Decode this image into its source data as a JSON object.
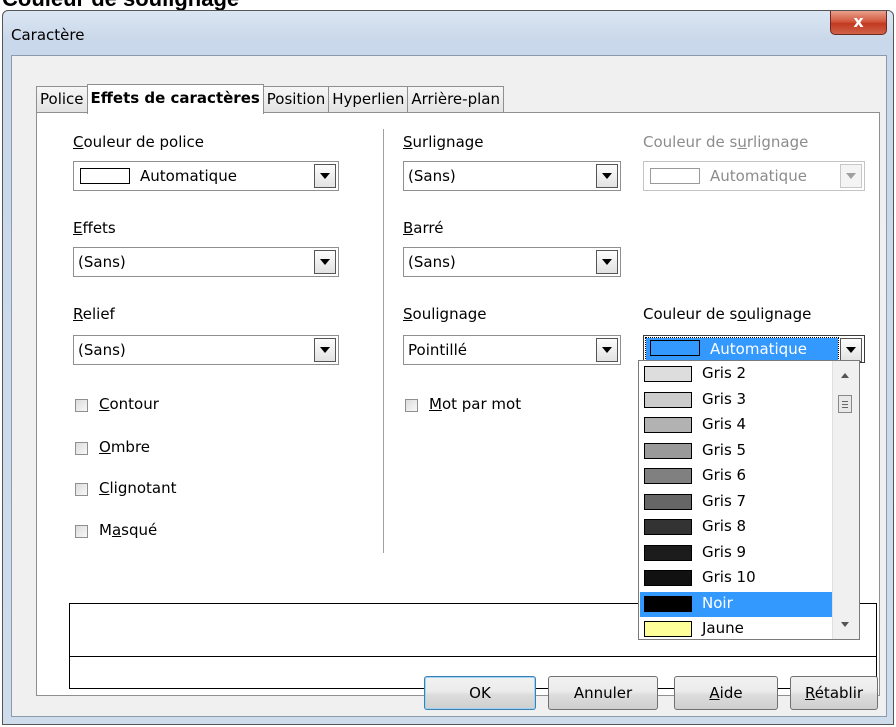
{
  "page_heading": "Couleur de soulignage",
  "dialog": {
    "title": "Caractère",
    "close_glyph": "x"
  },
  "tabs": [
    {
      "label": "Police"
    },
    {
      "label": "Effets de caractères",
      "active": true
    },
    {
      "label": "Position"
    },
    {
      "label": "Hyperlien"
    },
    {
      "label": "Arrière-plan"
    }
  ],
  "left_column": {
    "font_color": {
      "label_u": "C",
      "label_rest": "ouleur de police",
      "value": "Automatique"
    },
    "effects": {
      "label_u": "E",
      "label_rest": "ffets",
      "value": "(Sans)"
    },
    "relief": {
      "label_u": "R",
      "label_rest": "elief",
      "value": "(Sans)"
    },
    "checkboxes": [
      {
        "pre": "",
        "u": "C",
        "post": "ontour",
        "checked": false
      },
      {
        "pre": "",
        "u": "O",
        "post": "mbre",
        "checked": false
      },
      {
        "pre": "",
        "u": "C",
        "post": "lignotant",
        "checked": false
      },
      {
        "pre": "M",
        "u": "a",
        "post": "squé",
        "checked": false
      }
    ]
  },
  "middle_column": {
    "highlight": {
      "label_u": "S",
      "label_rest": "urlignage",
      "value": "(Sans)"
    },
    "strikethrough": {
      "label_u": "B",
      "label_rest": "arré",
      "value": "(Sans)"
    },
    "underline": {
      "label_u": "S",
      "label_rest": "oulignage",
      "value": "Pointillé"
    },
    "word_by_word": {
      "pre": "",
      "u": "M",
      "post": "ot par mot",
      "checked": false
    }
  },
  "right_column": {
    "highlight_color": {
      "label_pre": "Couleur de s",
      "label_u": "u",
      "label_post": "rlignage",
      "value": "Automatique"
    },
    "underline_color": {
      "label_pre": "Couleur de s",
      "label_u": "o",
      "label_post": "ulignage",
      "value": "Automatique",
      "swatch_color": "#3399ff"
    }
  },
  "color_list": [
    {
      "label": "Gris 2",
      "color": "#dddddd"
    },
    {
      "label": "Gris 3",
      "color": "#cccccc"
    },
    {
      "label": "Gris 4",
      "color": "#b2b2b2"
    },
    {
      "label": "Gris 5",
      "color": "#999999"
    },
    {
      "label": "Gris 6",
      "color": "#808080"
    },
    {
      "label": "Gris 7",
      "color": "#666666"
    },
    {
      "label": "Gris 8",
      "color": "#333333"
    },
    {
      "label": "Gris 9",
      "color": "#1c1c1c"
    },
    {
      "label": "Gris 10",
      "color": "#111111"
    },
    {
      "label": "Noir",
      "color": "#000000",
      "selected": true
    },
    {
      "label": "Jaune",
      "color": "#ffff99"
    }
  ],
  "buttons": {
    "ok": "OK",
    "cancel": "Annuler",
    "help": {
      "u": "A",
      "rest": "ide"
    },
    "reset": {
      "u": "R",
      "rest": "établir"
    }
  }
}
